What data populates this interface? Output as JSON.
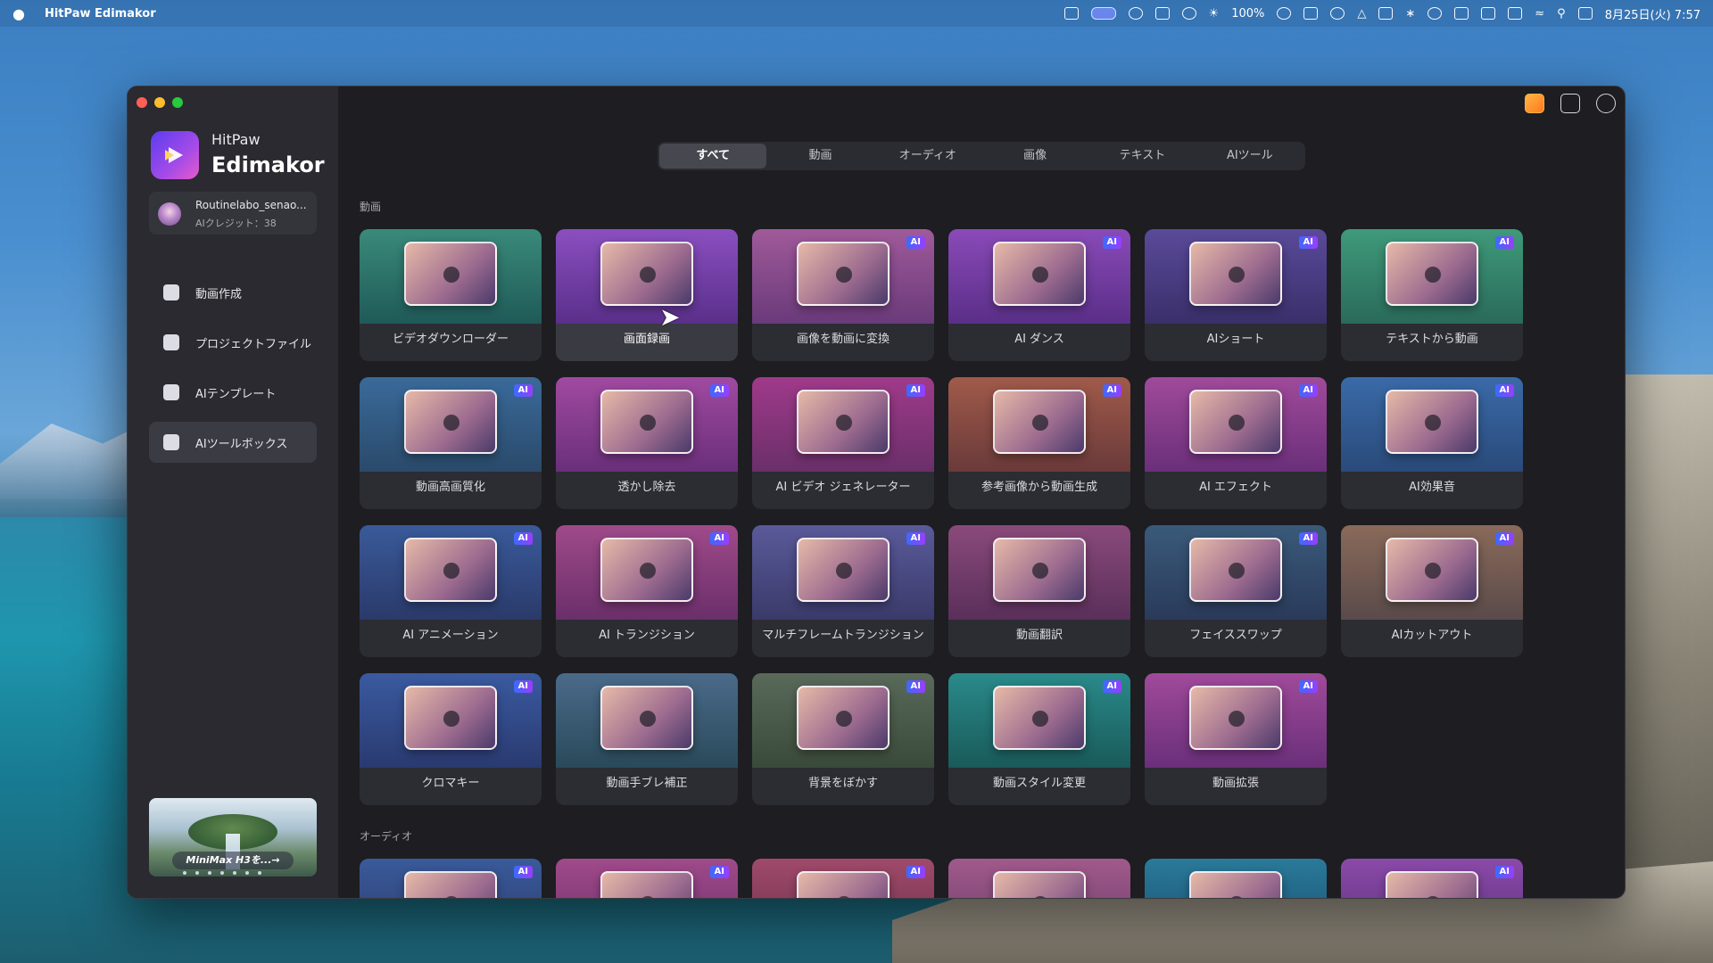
{
  "menubar": {
    "app_name": "HitPaw Edimakor",
    "battery_percent": "100%",
    "datetime": "8月25日(火) 7:57",
    "icons": [
      "apple-icon",
      "app-icon",
      "screen-icon",
      "chat-icon",
      "scan-icon",
      "send-icon",
      "brightness-icon",
      "info-icon",
      "translate-icon",
      "cloud-icon",
      "drive-icon",
      "shield-icon",
      "bluetooth-icon",
      "play-icon",
      "window-icon",
      "input-icon",
      "battery-icon",
      "wifi-icon",
      "search-icon",
      "control-center-icon"
    ]
  },
  "sidebar": {
    "brand_small": "HitPaw",
    "brand_big": "Edimakor",
    "account_name": "Routinelabo_senao...",
    "account_credit": "AIクレジット：38",
    "nav": [
      {
        "label": "動画作成",
        "icon": "video-create-icon"
      },
      {
        "label": "プロジェクトファイル",
        "icon": "project-file-icon"
      },
      {
        "label": "AIテンプレート",
        "icon": "ai-template-icon"
      },
      {
        "label": "AIツールボックス",
        "icon": "ai-toolbox-icon",
        "active": true
      }
    ],
    "promo_caption": "MiniMax H3を...→"
  },
  "tabs": [
    "すべて",
    "動画",
    "オーディオ",
    "画像",
    "テキスト",
    "AIツール"
  ],
  "active_tab": "すべて",
  "sections": {
    "video": "動画",
    "audio": "オーディオ"
  },
  "badge_label": "AI",
  "cards": [
    {
      "label": "ビデオダウンローダー",
      "ai": false,
      "colors": [
        "#3a8a7a",
        "#1f5a58"
      ]
    },
    {
      "label": "画面録画",
      "ai": false,
      "colors": [
        "#8a4fc0",
        "#5a2f8a"
      ]
    },
    {
      "label": "画像を動画に変換",
      "ai": true,
      "colors": [
        "#a05a9a",
        "#6a3a7a"
      ]
    },
    {
      "label": "AI ダンス",
      "ai": true,
      "colors": [
        "#8a4ab8",
        "#5a2f88"
      ]
    },
    {
      "label": "AIショート",
      "ai": true,
      "colors": [
        "#5a4a9a",
        "#3a2f6a"
      ]
    },
    {
      "label": "テキストから動画",
      "ai": true,
      "colors": [
        "#3f9a7a",
        "#2a6a5a"
      ]
    },
    {
      "label": "動画高画質化",
      "ai": true,
      "colors": [
        "#3a6a9a",
        "#2a4a6a"
      ]
    },
    {
      "label": "透かし除去",
      "ai": true,
      "colors": [
        "#a04aa0",
        "#6a2f7a"
      ]
    },
    {
      "label": "AI ビデオ ジェネレーター",
      "ai": true,
      "colors": [
        "#a03a8a",
        "#6a2f6a"
      ]
    },
    {
      "label": "参考画像から動画生成",
      "ai": true,
      "colors": [
        "#a05a4a",
        "#6a3a3a"
      ]
    },
    {
      "label": "AI エフェクト",
      "ai": true,
      "colors": [
        "#a04a9a",
        "#6a2f7a"
      ]
    },
    {
      "label": "AI効果音",
      "ai": true,
      "colors": [
        "#3a6aa8",
        "#2a4a7a"
      ]
    },
    {
      "label": "AI アニメーション",
      "ai": true,
      "colors": [
        "#3a5a9a",
        "#2a3a6a"
      ]
    },
    {
      "label": "AI トランジション",
      "ai": true,
      "colors": [
        "#a04a8a",
        "#6a2f6a"
      ]
    },
    {
      "label": "マルチフレームトランジション",
      "ai": true,
      "colors": [
        "#5a5a9a",
        "#3a3a6a"
      ]
    },
    {
      "label": "動画翻訳",
      "ai": false,
      "colors": [
        "#8a4a7a",
        "#5a2f5a"
      ]
    },
    {
      "label": "フェイススワップ",
      "ai": true,
      "colors": [
        "#3a5a7a",
        "#2a3a5a"
      ]
    },
    {
      "label": "AIカットアウト",
      "ai": true,
      "colors": [
        "#8a6a5a",
        "#5a4a4a"
      ]
    },
    {
      "label": "クロマキー",
      "ai": true,
      "colors": [
        "#3a5aa0",
        "#2a3a70"
      ]
    },
    {
      "label": "動画手ブレ補正",
      "ai": false,
      "colors": [
        "#4a6a8a",
        "#2a4a5a"
      ]
    },
    {
      "label": "背景をぼかす",
      "ai": true,
      "colors": [
        "#5a6a5a",
        "#3a4a3a"
      ]
    },
    {
      "label": "動画スタイル変更",
      "ai": true,
      "colors": [
        "#2a8a8a",
        "#1a5a5a"
      ]
    },
    {
      "label": "動画拡張",
      "ai": true,
      "colors": [
        "#a04a9a",
        "#6a2f7a"
      ]
    }
  ],
  "audio_cards": [
    {
      "ai": true,
      "colors": [
        "#3a5a9a",
        "#2a3a6a"
      ]
    },
    {
      "ai": true,
      "colors": [
        "#a04a8a",
        "#6a2f6a"
      ]
    },
    {
      "ai": true,
      "colors": [
        "#a04a6a",
        "#6a2f4a"
      ]
    },
    {
      "ai": false,
      "colors": [
        "#a05a8a",
        "#6a3a6a"
      ]
    },
    {
      "ai": false,
      "colors": [
        "#2a7a9a",
        "#1a4a6a"
      ]
    },
    {
      "ai": true,
      "colors": [
        "#8a4aa8",
        "#5a2f7a"
      ]
    }
  ]
}
